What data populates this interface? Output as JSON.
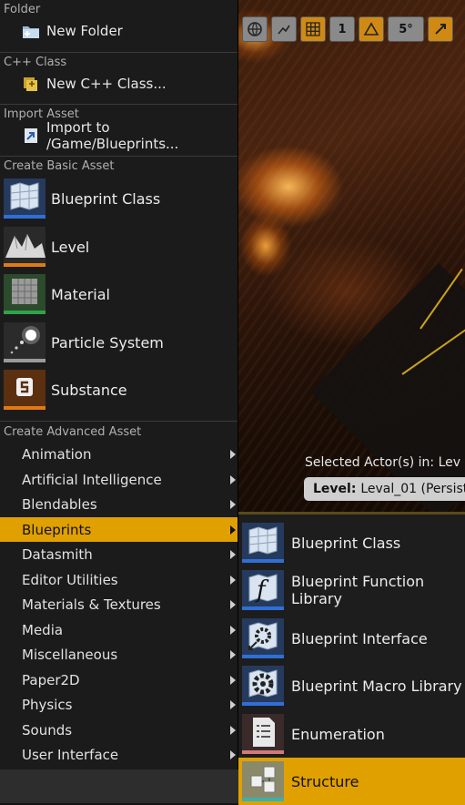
{
  "menu": {
    "sections": {
      "folder": "Folder",
      "cpp": "C++ Class",
      "import": "Import Asset",
      "basic": "Create Basic Asset",
      "advanced": "Create Advanced Asset"
    },
    "new_folder": "New Folder",
    "new_cpp": "New C++ Class...",
    "import_to": "Import to /Game/Blueprints...",
    "basic_assets": [
      {
        "label": "Blueprint Class",
        "icon": "blueprint-icon",
        "color": "#2f6fd6"
      },
      {
        "label": "Level",
        "icon": "level-icon",
        "color": "#e07a14"
      },
      {
        "label": "Material",
        "icon": "material-icon",
        "color": "#2fa24a"
      },
      {
        "label": "Particle System",
        "icon": "particle-icon",
        "color": "#9a9a9a"
      },
      {
        "label": "Substance",
        "icon": "substance-icon",
        "color": "#e07a14"
      }
    ],
    "categories": [
      "Animation",
      "Artificial Intelligence",
      "Blendables",
      "Blueprints",
      "Datasmith",
      "Editor Utilities",
      "Materials & Textures",
      "Media",
      "Miscellaneous",
      "Paper2D",
      "Physics",
      "Sounds",
      "User Interface"
    ],
    "active_category": "Blueprints",
    "highlight_color": "#e0a000"
  },
  "submenu": {
    "items": [
      {
        "label": "Blueprint Class",
        "icon": "blueprint-icon",
        "color": "#2f6fd6"
      },
      {
        "label": "Blueprint Function Library",
        "icon": "function-library-icon",
        "color": "#2f6fd6"
      },
      {
        "label": "Blueprint Interface",
        "icon": "interface-icon",
        "color": "#2f6fd6"
      },
      {
        "label": "Blueprint Macro Library",
        "icon": "macro-library-icon",
        "color": "#2f6fd6"
      },
      {
        "label": "Enumeration",
        "icon": "enumeration-icon",
        "color": "#d07a7a"
      },
      {
        "label": "Structure",
        "icon": "structure-icon",
        "color": "#3ab0b0"
      }
    ],
    "active_item": "Structure"
  },
  "viewport": {
    "toolbar": {
      "grid_snap": "1",
      "rotation_snap": "5°"
    },
    "selected_actors_label": "Selected Actor(s) in:",
    "selected_actors_suffix": "Lev",
    "level_label": "Level:",
    "level_name": "Leval_01 (Persiste"
  }
}
